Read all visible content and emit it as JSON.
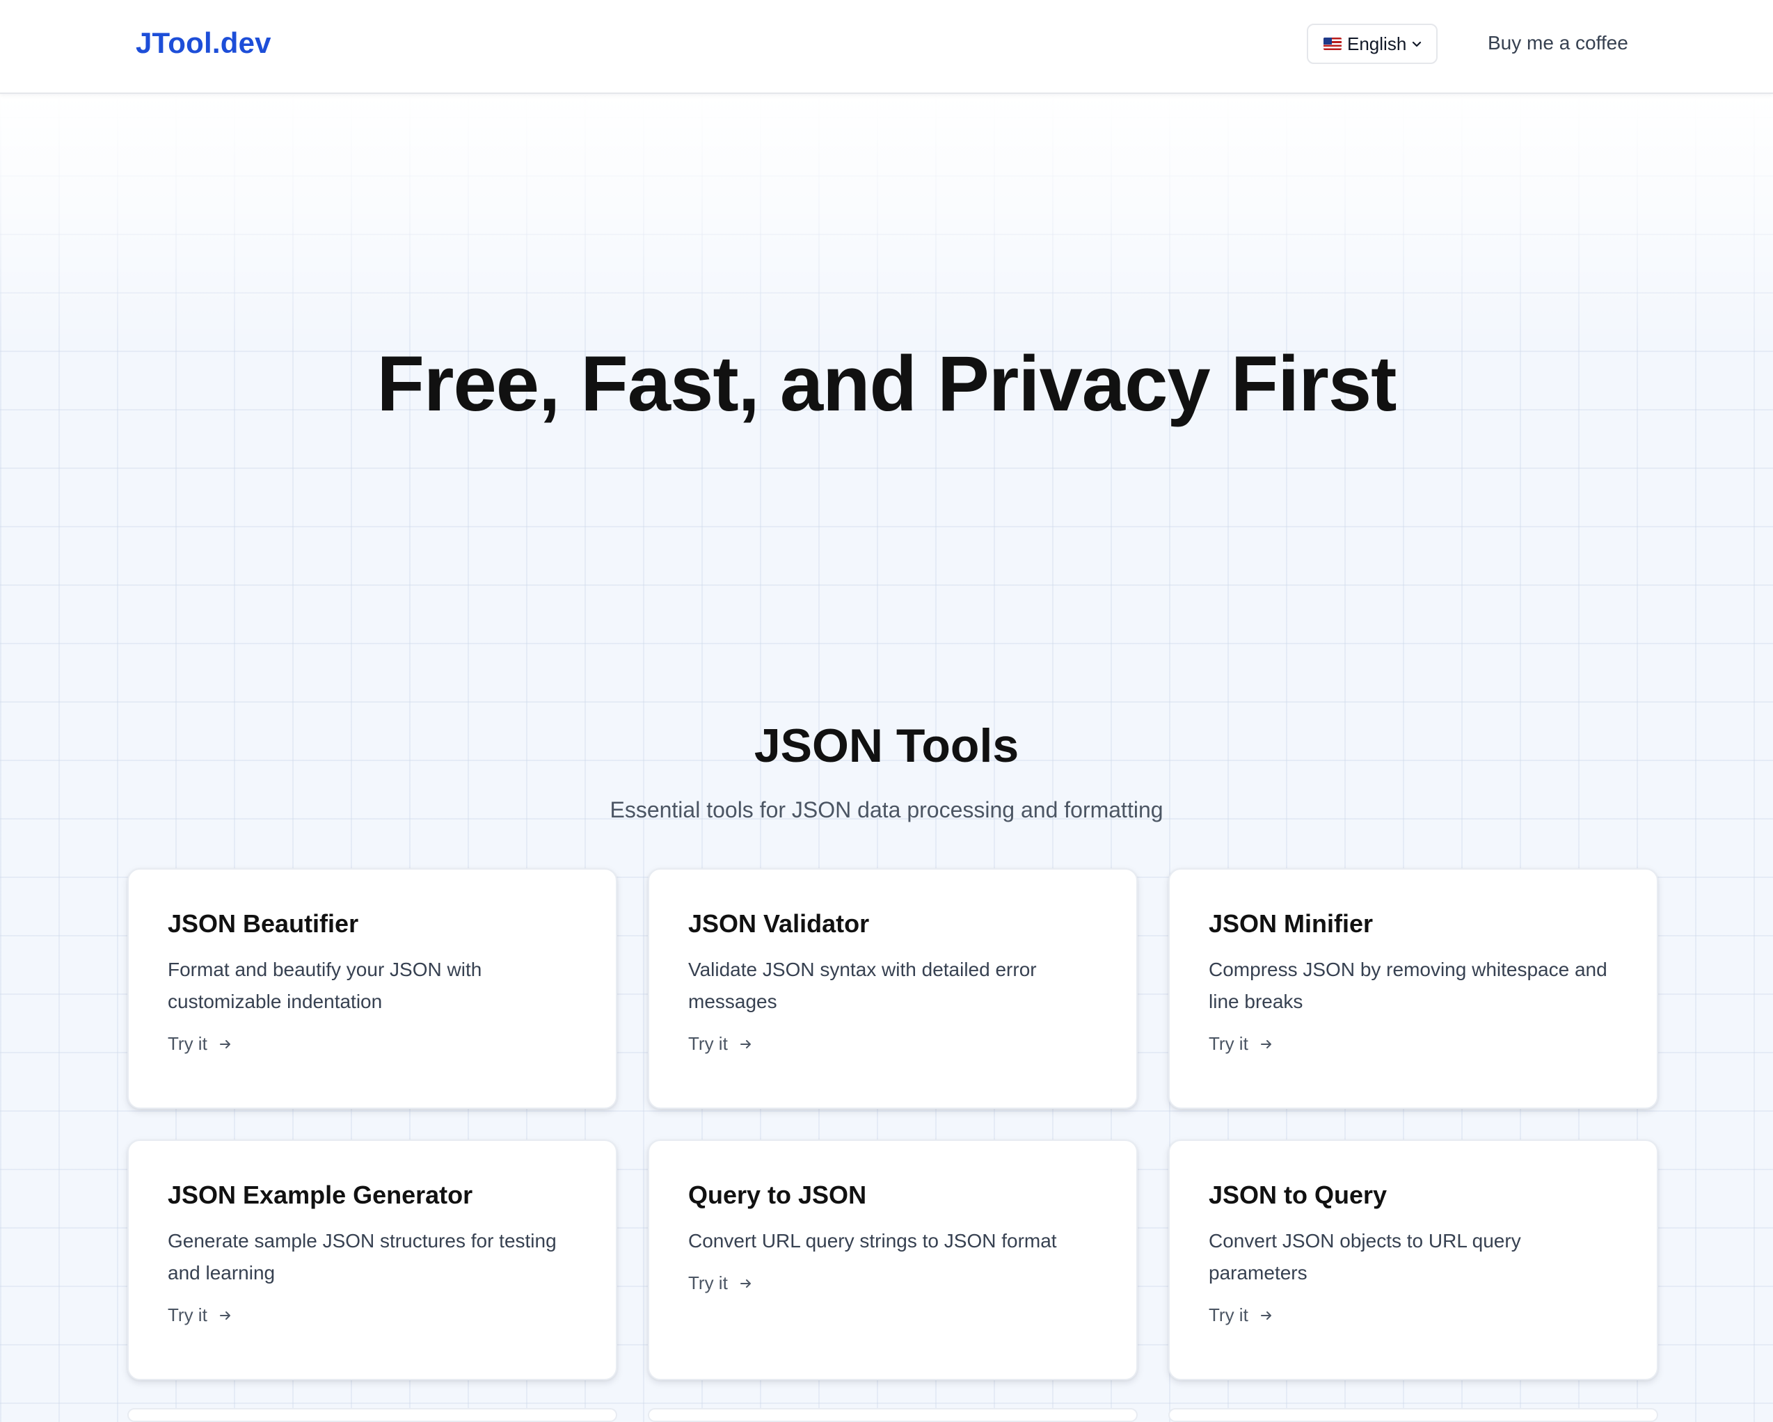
{
  "header": {
    "logo": "JTool.dev",
    "language": {
      "selected": "English",
      "flag_icon": "us-flag-icon",
      "chevron_icon": "chevron-down-icon"
    },
    "coffee_link": "Buy me a coffee"
  },
  "hero": {
    "title": "Free, Fast, and Privacy First"
  },
  "section": {
    "title": "JSON Tools",
    "subtitle": "Essential tools for JSON data processing and formatting"
  },
  "tools": [
    {
      "title": "JSON Beautifier",
      "description": "Format and beautify your JSON with customizable indentation",
      "cta": "Try it"
    },
    {
      "title": "JSON Validator",
      "description": "Validate JSON syntax with detailed error messages",
      "cta": "Try it"
    },
    {
      "title": "JSON Minifier",
      "description": "Compress JSON by removing whitespace and line breaks",
      "cta": "Try it"
    },
    {
      "title": "JSON Example Generator",
      "description": "Generate sample JSON structures for testing and learning",
      "cta": "Try it"
    },
    {
      "title": "Query to JSON",
      "description": "Convert URL query strings to JSON format",
      "cta": "Try it"
    },
    {
      "title": "JSON to Query",
      "description": "Convert JSON objects to URL query parameters",
      "cta": "Try it"
    }
  ],
  "colors": {
    "brand": "#1d4ed8",
    "text": "#111827",
    "muted": "#4b5563",
    "background": "#f3f7fd",
    "card": "#ffffff"
  }
}
